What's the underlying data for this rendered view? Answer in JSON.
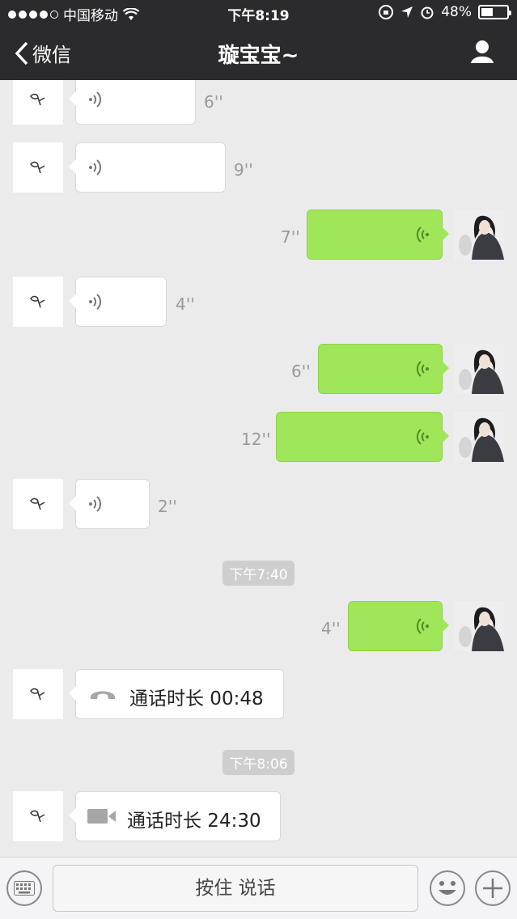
{
  "status_bar": {
    "carrier": "中国移动",
    "time": "下午8:19",
    "battery": "48%",
    "battery_level": 0.48
  },
  "nav": {
    "back_label": "微信",
    "title": "璇宝宝~"
  },
  "messages": [
    {
      "dir": "in",
      "duration": "6''"
    },
    {
      "dir": "in",
      "duration": "9''"
    },
    {
      "dir": "out",
      "duration": "7''"
    },
    {
      "dir": "in",
      "duration": "4''"
    },
    {
      "dir": "out",
      "duration": "6''"
    },
    {
      "dir": "out",
      "duration": "12''"
    },
    {
      "dir": "in",
      "duration": "2''"
    },
    {
      "dir": "out",
      "duration": "4''"
    }
  ],
  "timestamps": [
    "下午7:40",
    "下午8:06"
  ],
  "calls": [
    {
      "type": "voice",
      "icon": "phone-icon",
      "text": "通话时长 00:48"
    },
    {
      "type": "video",
      "icon": "video-camera-icon",
      "text": "通话时长 24:30"
    }
  ],
  "input": {
    "hold_to_talk": "按住 说话"
  },
  "colors": {
    "nav_bg": "#2b2b2d",
    "chat_bg": "#ebebeb",
    "out_bubble": "#9fe658"
  }
}
